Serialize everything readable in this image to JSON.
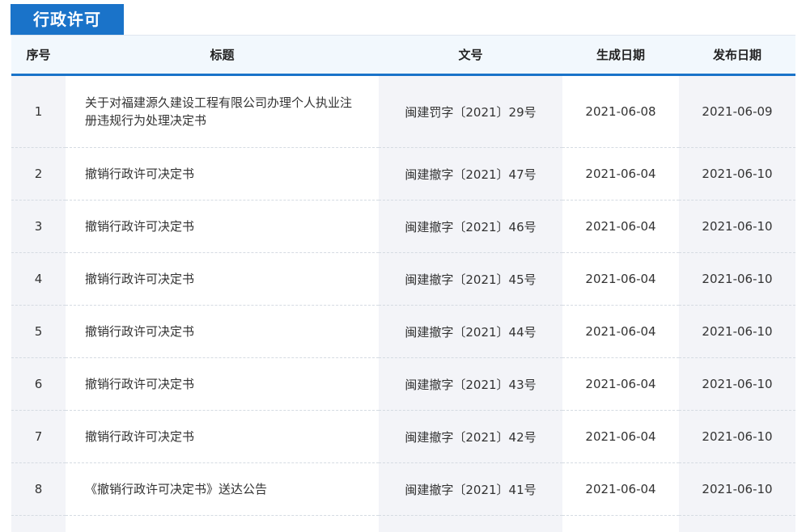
{
  "tab_title": "行政许可",
  "columns": [
    "序号",
    "标题",
    "文号",
    "生成日期",
    "发布日期"
  ],
  "rows": [
    {
      "no": "1",
      "title": "关于对福建源久建设工程有限公司办理个人执业注册违规行为处理决定书",
      "doc_no": "闽建罚字〔2021〕29号",
      "created": "2021-06-08",
      "published": "2021-06-09"
    },
    {
      "no": "2",
      "title": "撤销行政许可决定书",
      "doc_no": "闽建撤字〔2021〕47号",
      "created": "2021-06-04",
      "published": "2021-06-10"
    },
    {
      "no": "3",
      "title": "撤销行政许可决定书",
      "doc_no": "闽建撤字〔2021〕46号",
      "created": "2021-06-04",
      "published": "2021-06-10"
    },
    {
      "no": "4",
      "title": "撤销行政许可决定书",
      "doc_no": "闽建撤字〔2021〕45号",
      "created": "2021-06-04",
      "published": "2021-06-10"
    },
    {
      "no": "5",
      "title": "撤销行政许可决定书",
      "doc_no": "闽建撤字〔2021〕44号",
      "created": "2021-06-04",
      "published": "2021-06-10"
    },
    {
      "no": "6",
      "title": "撤销行政许可决定书",
      "doc_no": "闽建撤字〔2021〕43号",
      "created": "2021-06-04",
      "published": "2021-06-10"
    },
    {
      "no": "7",
      "title": "撤销行政许可决定书",
      "doc_no": "闽建撤字〔2021〕42号",
      "created": "2021-06-04",
      "published": "2021-06-10"
    },
    {
      "no": "8",
      "title": "《撤销行政许可决定书》送达公告",
      "doc_no": "闽建撤字〔2021〕41号",
      "created": "2021-06-04",
      "published": "2021-06-10"
    }
  ],
  "colors": {
    "accent": "#1a73c9",
    "header_bg": "#f2f8fd",
    "shaded_col": "#f3f4f8"
  }
}
